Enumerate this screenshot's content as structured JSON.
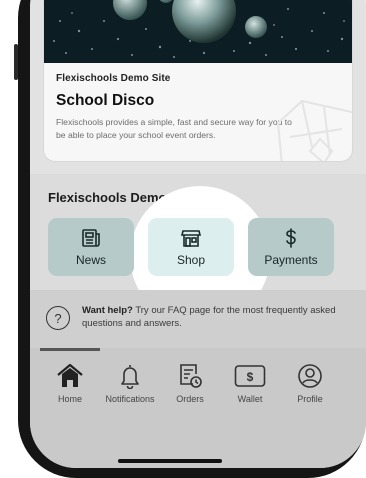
{
  "event": {
    "site_name": "Flexischools Demo Site",
    "title": "School Disco",
    "description": "Flexischools provides a simple, fast and secure way for you to be able to place your school event orders."
  },
  "services": {
    "site_name": "Flexischools Demo Site",
    "tiles": [
      {
        "label": "News",
        "icon": "newspaper-icon"
      },
      {
        "label": "Shop",
        "icon": "storefront-icon"
      },
      {
        "label": "Payments",
        "icon": "dollar-icon"
      }
    ]
  },
  "help": {
    "icon": "question-icon",
    "lead": "Want help?",
    "text": "Try our FAQ page for the most frequently asked questions and answers."
  },
  "nav": {
    "items": [
      {
        "label": "Home",
        "icon": "home-icon",
        "active": true
      },
      {
        "label": "Notifications",
        "icon": "bell-icon"
      },
      {
        "label": "Orders",
        "icon": "orders-icon"
      },
      {
        "label": "Wallet",
        "icon": "wallet-icon"
      },
      {
        "label": "Profile",
        "icon": "profile-icon"
      }
    ]
  },
  "colors": {
    "tile": "#b6caca",
    "panel": "#dcdcdc",
    "nav": "#c9c9c9",
    "spotlight": "#ffffff"
  }
}
